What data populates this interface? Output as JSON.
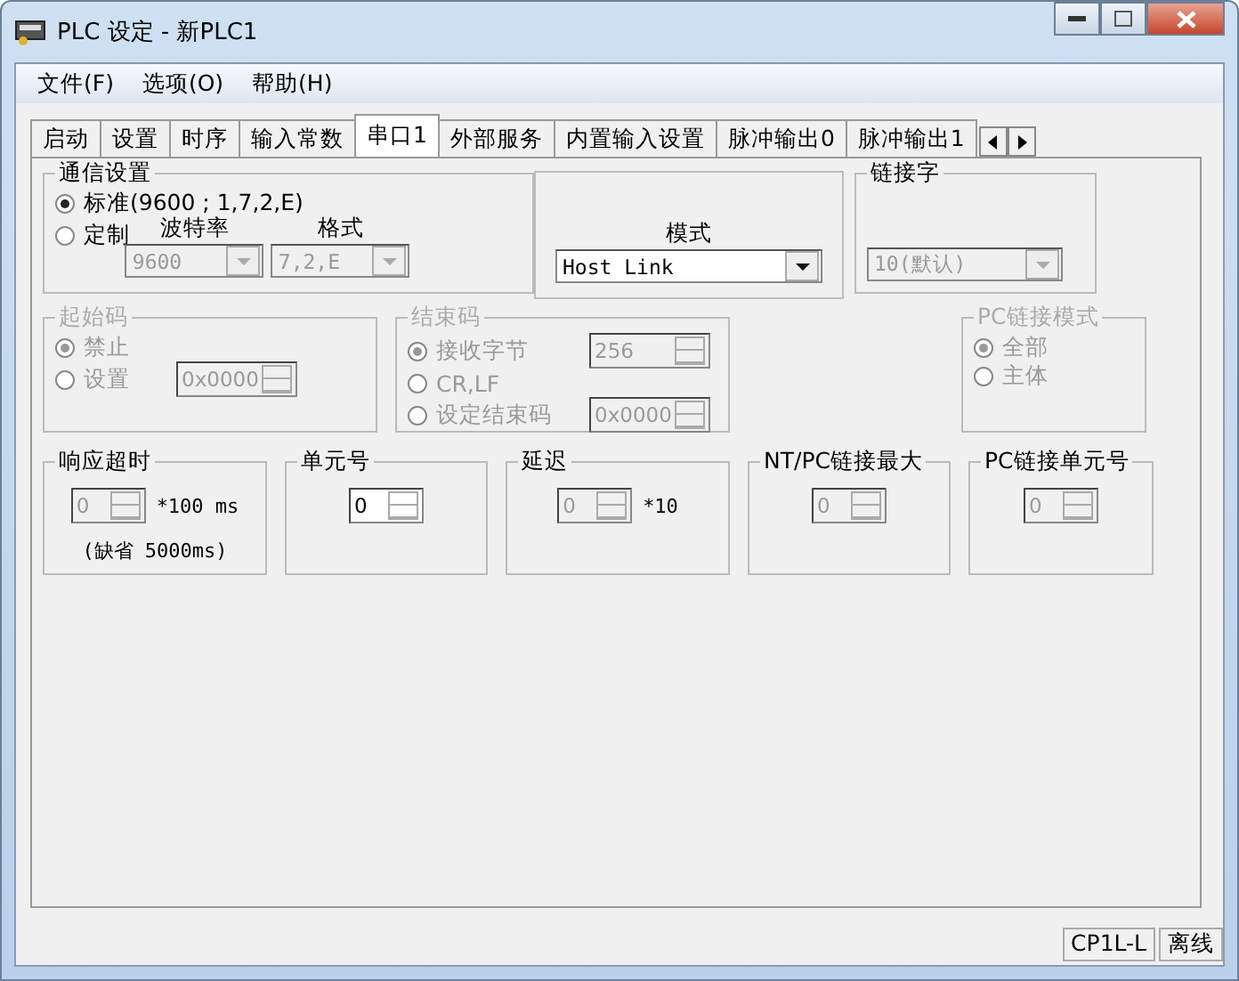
{
  "window": {
    "title": "PLC 设定 - 新PLC1"
  },
  "menu": [
    "文件(F)",
    "选项(O)",
    "帮助(H)"
  ],
  "tabs": [
    {
      "label": "启动",
      "selected": false
    },
    {
      "label": "设置",
      "selected": false
    },
    {
      "label": "时序",
      "selected": false
    },
    {
      "label": "输入常数",
      "selected": false
    },
    {
      "label": "串口1",
      "selected": true
    },
    {
      "label": "外部服务",
      "selected": false
    },
    {
      "label": "内置输入设置",
      "selected": false
    },
    {
      "label": "脉冲输出0",
      "selected": false
    },
    {
      "label": "脉冲输出1",
      "selected": false
    }
  ],
  "comm_settings": {
    "title": "通信设置",
    "options": [
      {
        "label": "标准(9600 ; 1,7,2,E)",
        "selected": true
      },
      {
        "label": "定制",
        "selected": false
      }
    ],
    "baud": {
      "label": "波特率",
      "value": "9600",
      "disabled": true
    },
    "format": {
      "label": "格式",
      "value": "7,2,E",
      "disabled": true
    }
  },
  "mode": {
    "label": "模式",
    "value": "Host Link",
    "disabled": false
  },
  "link_word": {
    "title": "链接字",
    "value": "10(默认)",
    "disabled": true
  },
  "start_code": {
    "title": "起始码",
    "disabled": true,
    "options": [
      {
        "label": "禁止",
        "selected": true
      },
      {
        "label": "设置",
        "selected": false
      }
    ],
    "value": "0x0000"
  },
  "end_code": {
    "title": "结束码",
    "disabled": true,
    "options": [
      {
        "label": "接收字节",
        "selected": true,
        "value": "256"
      },
      {
        "label": "CR,LF",
        "selected": false
      },
      {
        "label": "设定结束码",
        "selected": false,
        "value": "0x0000"
      }
    ]
  },
  "pc_link_mode": {
    "title": "PC链接模式",
    "disabled": true,
    "options": [
      {
        "label": "全部",
        "selected": true
      },
      {
        "label": "主体",
        "selected": false
      }
    ]
  },
  "spin_groups": [
    {
      "title": "响应超时",
      "value": "0",
      "disabled": true,
      "unit": "*100 ms",
      "note": "(缺省 5000ms)"
    },
    {
      "title": "单元号",
      "value": "0",
      "disabled": false
    },
    {
      "title": "延迟",
      "value": "0",
      "disabled": true,
      "unit": "*10"
    },
    {
      "title": "NT/PC链接最大",
      "value": "0",
      "disabled": true
    },
    {
      "title": "PC链接单元号",
      "value": "0",
      "disabled": true
    }
  ],
  "status_bar": [
    "CP1L-L",
    "离线"
  ]
}
